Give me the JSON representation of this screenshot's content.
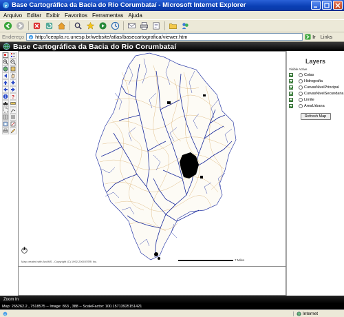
{
  "window": {
    "title": "Base Cartográfica da Bacia do Rio Corumbataí - Microsoft Internet Explorer"
  },
  "menu": [
    "Arquivo",
    "Editar",
    "Exibir",
    "Favoritos",
    "Ferramentas",
    "Ajuda"
  ],
  "address": {
    "label": "Endereço",
    "url": "http://ceapla.rc.unesp.br/website/atlas/basecartografica/viewer.htm",
    "go_label": "Ir",
    "links_label": "Links"
  },
  "app": {
    "title": "Base Cartográfica da Bacia do Rio Corumbataí"
  },
  "map": {
    "copyright": "Map created with ArcIMS - Copyright (C) 1992-2000 ESRI Inc.",
    "scale_label": "7 Miles"
  },
  "layers": {
    "title": "Layers",
    "header": "Visible Active",
    "items": [
      {
        "name": "Cotas"
      },
      {
        "name": "Hidrografia"
      },
      {
        "name": "CurvasNivelPrincipal"
      },
      {
        "name": "CurvasNivelSecundaria"
      },
      {
        "name": "Limite"
      },
      {
        "name": "AreaUrbana"
      }
    ],
    "refresh_label": "Refresh Map"
  },
  "status": {
    "mode": "Zoom In",
    "coords": "Map: 265262.2 , 7518575 -- Image: 863 , 388 -- ScaleFactor: 100.15713925151421"
  },
  "ie_status": {
    "zone": "Internet"
  },
  "colors": {
    "titlebar": "#0a3fb4",
    "rivers": "#1a2a9c",
    "contours": "#d9b070",
    "urban": "#000000"
  }
}
